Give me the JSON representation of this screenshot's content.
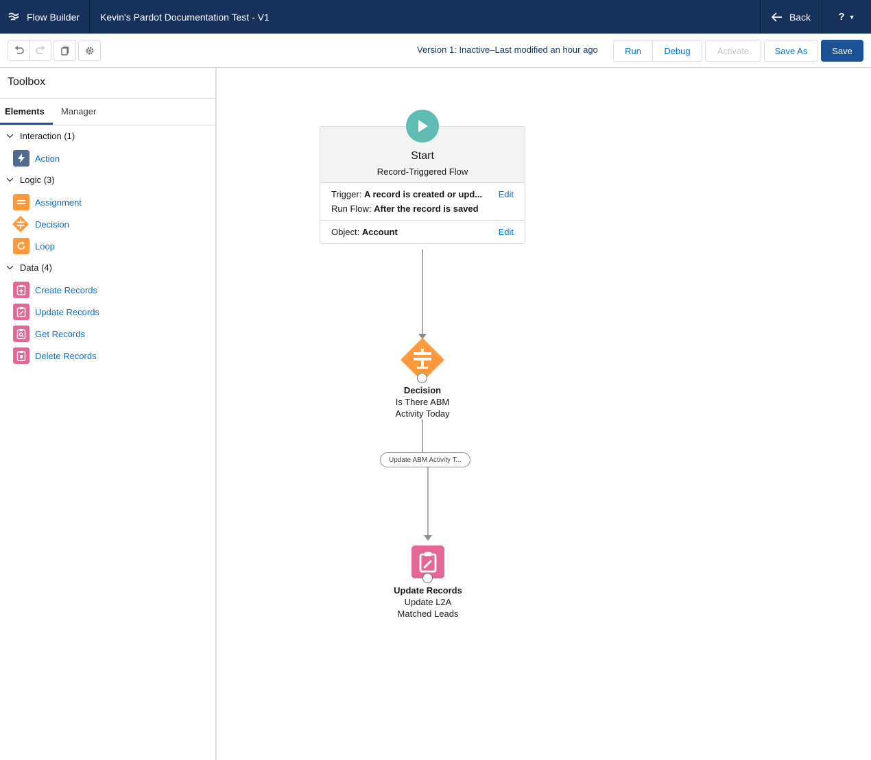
{
  "header": {
    "app_name": "Flow Builder",
    "flow_title": "Kevin's Pardot Documentation Test - V1",
    "back_label": "Back",
    "help_label": "?"
  },
  "toolbar": {
    "version_text": "Version 1: Inactive–Last modified an hour ago",
    "run_label": "Run",
    "debug_label": "Debug",
    "activate_label": "Activate",
    "save_as_label": "Save As",
    "save_label": "Save"
  },
  "sidebar": {
    "title": "Toolbox",
    "tabs": [
      {
        "label": "Elements",
        "active": true
      },
      {
        "label": "Manager",
        "active": false
      }
    ],
    "groups": [
      {
        "label": "Interaction (1)",
        "items": [
          {
            "label": "Action",
            "icon": "lightning-icon",
            "color": "#54698d"
          }
        ]
      },
      {
        "label": "Logic (3)",
        "items": [
          {
            "label": "Assignment",
            "icon": "assignment-icon",
            "color": "#ff9a3c"
          },
          {
            "label": "Decision",
            "icon": "decision-icon",
            "color": "#ff9a3c"
          },
          {
            "label": "Loop",
            "icon": "loop-icon",
            "color": "#ff9a3c"
          }
        ]
      },
      {
        "label": "Data (4)",
        "items": [
          {
            "label": "Create Records",
            "icon": "create-records-icon",
            "color": "#e56798"
          },
          {
            "label": "Update Records",
            "icon": "update-records-icon",
            "color": "#e56798"
          },
          {
            "label": "Get Records",
            "icon": "get-records-icon",
            "color": "#e56798"
          },
          {
            "label": "Delete Records",
            "icon": "delete-records-icon",
            "color": "#e56798"
          }
        ]
      }
    ]
  },
  "canvas": {
    "start": {
      "title": "Start",
      "subtitle": "Record-Triggered Flow",
      "trigger_label": "Trigger:",
      "trigger_value": "A record is created or upd...",
      "run_flow_label": "Run Flow:",
      "run_flow_value": "After the record is saved",
      "object_label": "Object:",
      "object_value": "Account",
      "edit_label": "Edit"
    },
    "decision": {
      "type_label": "Decision",
      "name_line1": "Is There ABM",
      "name_line2": "Activity Today",
      "outcome_label": "Update ABM Activity T..."
    },
    "update_records": {
      "type_label": "Update Records",
      "name_line1": "Update L2A",
      "name_line2": "Matched Leads"
    },
    "colors": {
      "start": "#5fbcb5",
      "decision": "#ff9a3c",
      "update": "#e56798",
      "connector": "#8c8c8c"
    }
  }
}
